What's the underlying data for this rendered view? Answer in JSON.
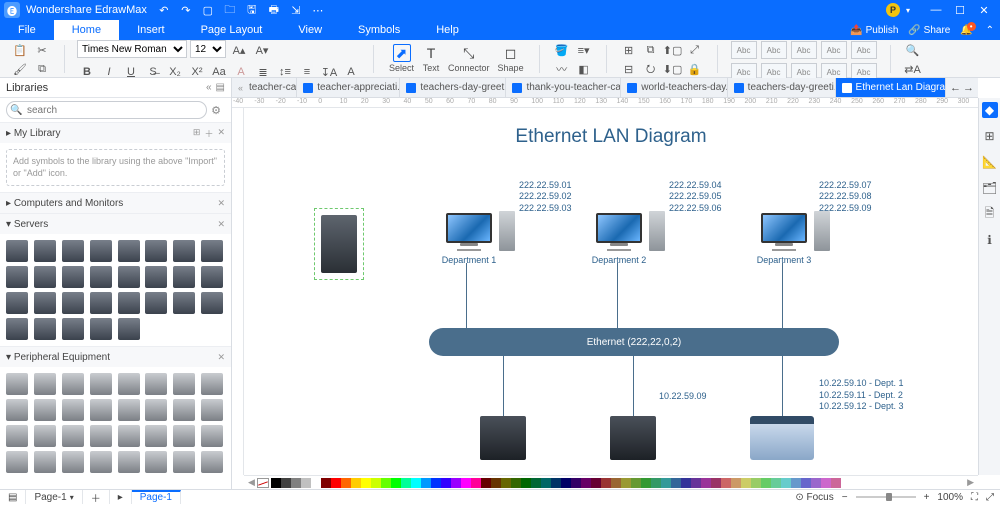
{
  "app": {
    "name": "Wondershare EdrawMax"
  },
  "titlebar": {
    "publish": "Publish",
    "share": "Share",
    "avatar": "P"
  },
  "menu": {
    "items": [
      "File",
      "Home",
      "Insert",
      "Page Layout",
      "View",
      "Symbols",
      "Help"
    ],
    "active": "Home"
  },
  "ribbon": {
    "font": "Times New Roman",
    "fontsize": "12",
    "tools": {
      "select": "Select",
      "text": "Text",
      "connector": "Connector",
      "shape": "Shape"
    },
    "styleSample": "Abc"
  },
  "libraries": {
    "header": "Libraries",
    "searchPlaceholder": "search",
    "sections": {
      "mylib": {
        "title": "My Library",
        "hint": "Add symbols to the library using the above \"Import\" or \"Add\" icon."
      },
      "compmon": {
        "title": "Computers and Monitors"
      },
      "servers": {
        "title": "Servers"
      },
      "peripheral": {
        "title": "Peripheral Equipment"
      }
    }
  },
  "tabs": [
    {
      "label": "teacher-card"
    },
    {
      "label": "teacher-appreciati..."
    },
    {
      "label": "teachers-day-greet..."
    },
    {
      "label": "thank-you-teacher-card"
    },
    {
      "label": "world-teachers-day..."
    },
    {
      "label": "teachers-day-greeti..."
    },
    {
      "label": "Ethernet Lan Diagram",
      "active": true
    }
  ],
  "ruler": [
    -40,
    -30,
    -20,
    -10,
    0,
    10,
    20,
    30,
    40,
    50,
    60,
    70,
    80,
    90,
    100,
    110,
    120,
    130,
    140,
    150,
    160,
    170,
    180,
    190,
    200,
    210,
    220,
    230,
    240,
    250,
    260,
    270,
    280,
    290,
    300
  ],
  "canvas": {
    "title": "Ethernet LAN Diagram",
    "ipBlocks": [
      [
        "222.22.59.01",
        "222.22.59.02",
        "222.22.59.03"
      ],
      [
        "222.22.59.04",
        "222.22.59.05",
        "222.22.59.06"
      ],
      [
        "222.22.59.07",
        "222.22.59.08",
        "222.22.59.09"
      ]
    ],
    "departments": [
      "Department 1",
      "Department 2",
      "Department 3"
    ],
    "hubLabel": "Ethernet (222,22,0,2)",
    "bottomIp": "10.22.59.09",
    "deptIps": [
      "10.22.59.10 - Dept. 1",
      "10.22.59.11 - Dept. 2",
      "10.22.59.12 - Dept. 3"
    ]
  },
  "colors": [
    "#000000",
    "#404040",
    "#808080",
    "#c0c0c0",
    "#ffffff",
    "#800000",
    "#ff0000",
    "#ff6600",
    "#ffcc00",
    "#ffff00",
    "#ccff00",
    "#66ff00",
    "#00ff00",
    "#00ff99",
    "#00ffff",
    "#0099ff",
    "#0033ff",
    "#3300ff",
    "#9900ff",
    "#ff00ff",
    "#ff0099",
    "#660000",
    "#663300",
    "#666600",
    "#336600",
    "#006600",
    "#006633",
    "#006666",
    "#003366",
    "#000066",
    "#330066",
    "#660066",
    "#660033",
    "#993333",
    "#996633",
    "#999933",
    "#669933",
    "#339933",
    "#339966",
    "#339999",
    "#336699",
    "#333399",
    "#663399",
    "#993399",
    "#993366",
    "#cc6666",
    "#cc9966",
    "#cccc66",
    "#99cc66",
    "#66cc66",
    "#66cc99",
    "#66cccc",
    "#6699cc",
    "#6666cc",
    "#9966cc",
    "#cc66cc",
    "#cc6699"
  ],
  "status": {
    "pageLabel": "Page-1",
    "pageLabel2": "Page-1",
    "focus": "Focus",
    "zoom": "100%"
  }
}
